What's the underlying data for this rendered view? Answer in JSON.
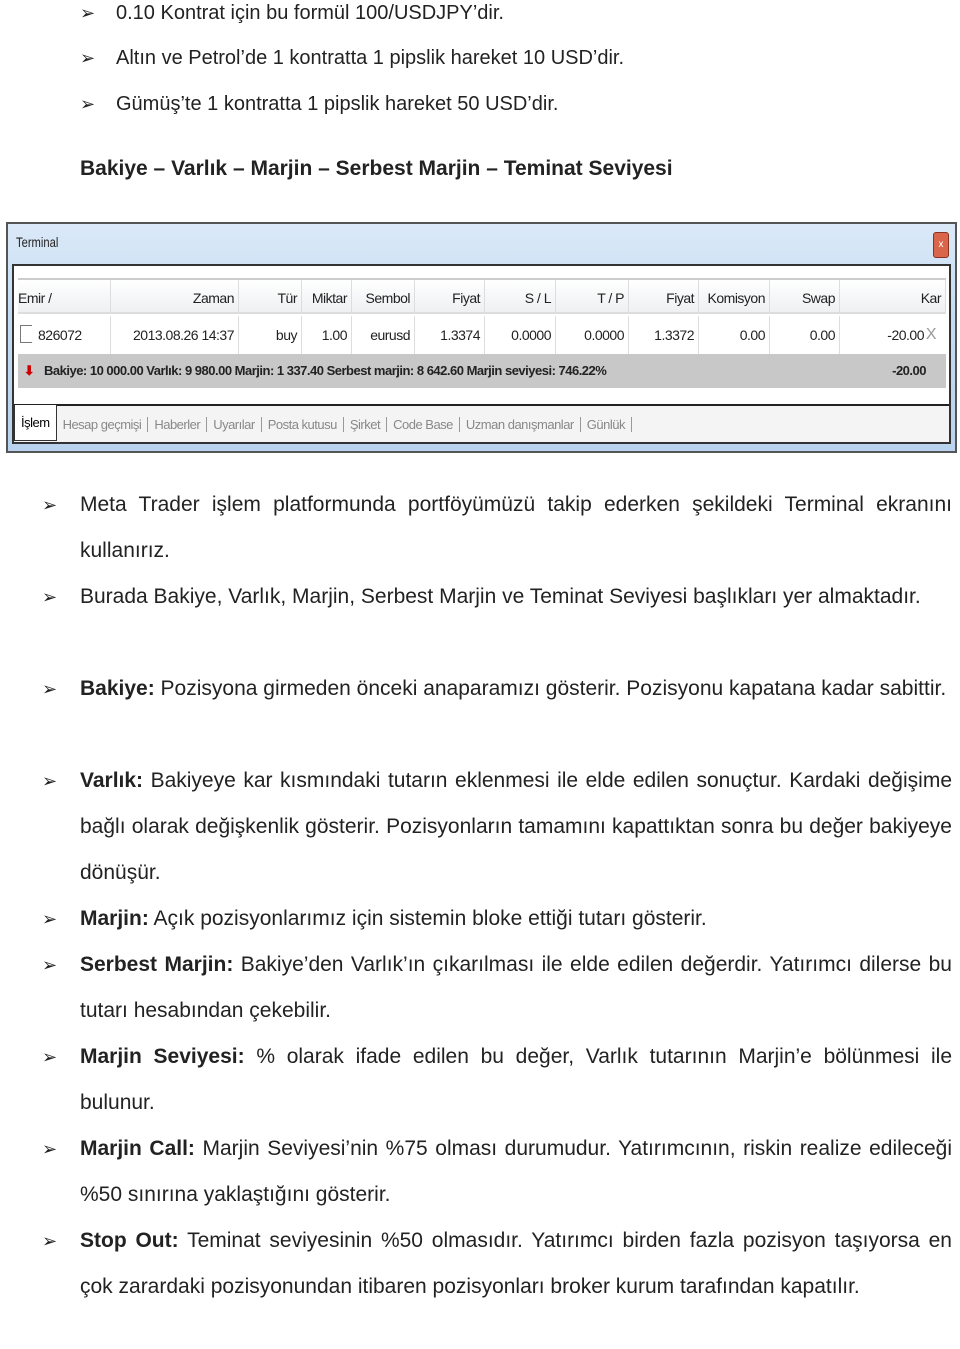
{
  "top_bullets": [
    "0.10 Kontrat için bu formül 100/USDJPY’dir.",
    "Altın ve Petrol’de 1 kontratta 1 pipslik hareket 10 USD’dir.",
    "Gümüş’te 1 kontratta 1 pipslik hareket 50 USD’dir."
  ],
  "heading": "Bakiye – Varlık – Marjin – Serbest Marjin – Teminat Seviyesi",
  "terminal": {
    "title": "Terminal",
    "close": "x",
    "columns": [
      "Emir  /",
      "Zaman",
      "Tür",
      "Miktar",
      "Sembol",
      "Fiyat",
      "S / L",
      "T / P",
      "Fiyat",
      "Komisyon",
      "Swap",
      "Kar"
    ],
    "row": [
      "826072",
      "2013.08.26 14:37",
      "buy",
      "1.00",
      "eurusd",
      "1.3374",
      "0.0000",
      "0.0000",
      "1.3372",
      "0.00",
      "0.00",
      "-20.00"
    ],
    "row_close": "X",
    "summary": "Bakiye: 10 000.00  Varlık: 9 980.00  Marjin: 1 337.40  Serbest marjin: 8 642.60  Marjin seviyesi: 746.22%",
    "summary_profit": "-20.00",
    "tabs": [
      "İşlem",
      "Hesap geçmişi",
      "Haberler",
      "Uyarılar",
      "Posta kutusu",
      "Şirket",
      "Code Base",
      "Uzman danışmanlar",
      "Günlük"
    ]
  },
  "bullets": [
    {
      "term": "",
      "text": "Meta Trader işlem platformunda portföyümüzü takip ederken şekildeki Terminal ekranını kullanırız."
    },
    {
      "term": "",
      "text": "Burada Bakiye, Varlık, Marjin, Serbest Marjin ve Teminat Seviyesi başlıkları yer almaktadır."
    },
    {
      "term": "Bakiye:",
      "text": " Pozisyona girmeden önceki anaparamızı gösterir. Pozisyonu kapatana kadar sabittir."
    },
    {
      "term": "Varlık:",
      "text": " Bakiyeye kar kısmındaki tutarın eklenmesi ile elde edilen sonuçtur. Kardaki değişime bağlı olarak değişkenlik gösterir. Pozisyonların tamamını kapattıktan sonra bu değer bakiyeye dönüşür."
    },
    {
      "term": "Marjin:",
      "text": " Açık pozisyonlarımız için sistemin bloke ettiği tutarı gösterir."
    },
    {
      "term": "Serbest Marjin:",
      "text": " Bakiye’den Varlık’ın çıkarılması ile elde edilen değerdir. Yatırımcı dilerse bu tutarı hesabından çekebilir."
    },
    {
      "term": "Marjin Seviyesi:",
      "text": " % olarak ifade edilen bu değer, Varlık tutarının Marjin’e bölünmesi ile bulunur."
    },
    {
      "term": "Marjin Call:",
      "text": " Marjin Seviyesi’nin %75 olması durumudur. Yatırımcının, riskin realize edileceği %50 sınırına yaklaştığını gösterir."
    },
    {
      "term": "Stop Out:",
      "text": " Teminat seviyesinin %50 olmasıdır. Yatırımcı birden fazla pozisyon taşıyorsa en çok zarardaki pozisyonundan itibaren pozisyonları broker kurum tarafından kapatılır."
    }
  ],
  "bullet_glyph": "➢"
}
